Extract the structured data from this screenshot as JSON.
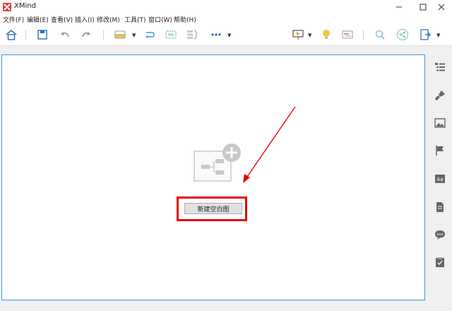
{
  "window": {
    "title": "XMind"
  },
  "menu": {
    "items": [
      "文件(F)",
      "编辑(E)",
      "查看(V)",
      "插入(I)",
      "修改(M)",
      "工具(T)",
      "窗口(W)",
      "帮助(H)"
    ]
  },
  "toolbar": {
    "icons": [
      "home-icon",
      "save-icon",
      "undo-icon",
      "redo-icon",
      "topic-icon",
      "relationship-icon",
      "boundary-icon",
      "summary-icon",
      "more-icon",
      "presentation-icon",
      "brainstorm-icon",
      "gantt-icon",
      "zoom-icon",
      "share-icon",
      "export-icon"
    ]
  },
  "canvas": {
    "new_blank_button": "新建空白图"
  },
  "colors": {
    "accent": "#3a9bd8",
    "highlight": "#e60000",
    "brand": "#d93a3a"
  }
}
